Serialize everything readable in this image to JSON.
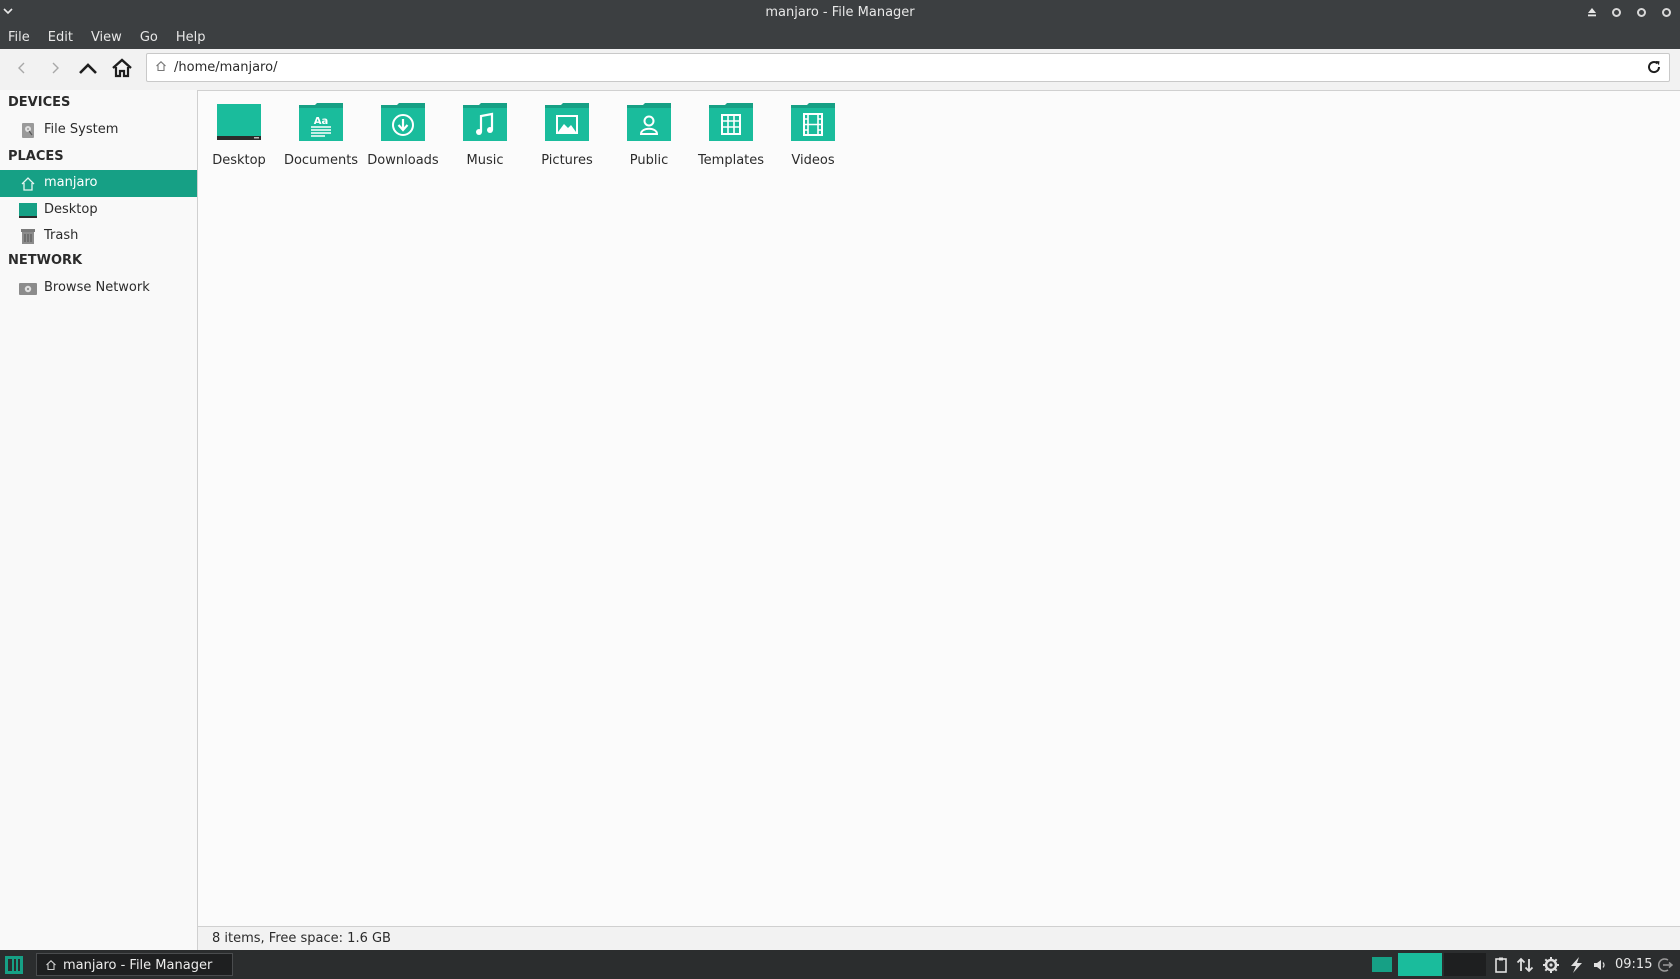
{
  "window": {
    "title": "manjaro - File Manager"
  },
  "menubar": [
    "File",
    "Edit",
    "View",
    "Go",
    "Help"
  ],
  "toolbar": {
    "path": "/home/manjaro/"
  },
  "sidebar": {
    "devices_header": "DEVICES",
    "devices": [
      {
        "label": "File System",
        "icon": "drive-icon"
      }
    ],
    "places_header": "PLACES",
    "places": [
      {
        "label": "manjaro",
        "icon": "home-icon",
        "active": true
      },
      {
        "label": "Desktop",
        "icon": "desktop-icon"
      },
      {
        "label": "Trash",
        "icon": "trash-icon"
      }
    ],
    "network_header": "NETWORK",
    "network": [
      {
        "label": "Browse Network",
        "icon": "network-drive-icon"
      }
    ]
  },
  "folders": [
    {
      "name": "Desktop",
      "icon": "desktop-folder-icon"
    },
    {
      "name": "Documents",
      "icon": "documents-folder-icon"
    },
    {
      "name": "Downloads",
      "icon": "downloads-folder-icon"
    },
    {
      "name": "Music",
      "icon": "music-folder-icon"
    },
    {
      "name": "Pictures",
      "icon": "pictures-folder-icon"
    },
    {
      "name": "Public",
      "icon": "public-folder-icon"
    },
    {
      "name": "Templates",
      "icon": "templates-folder-icon"
    },
    {
      "name": "Videos",
      "icon": "videos-folder-icon"
    }
  ],
  "status": {
    "text": "8 items, Free space: 1.6 GB"
  },
  "taskbar": {
    "task_label": "manjaro - File Manager",
    "clock": "09:15"
  },
  "colors": {
    "accent": "#16a085",
    "accent_light": "#1abc9c",
    "titlebar": "#3c3f41",
    "taskbar": "#2b2d2e"
  }
}
